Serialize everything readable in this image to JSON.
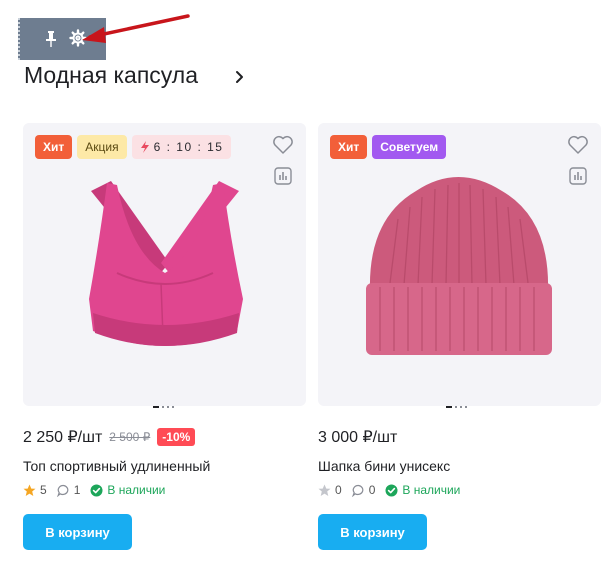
{
  "section": {
    "title": "Модная капсула"
  },
  "products": [
    {
      "badges": {
        "hit": "Хит",
        "sale": "Акция",
        "timer": "6 : 10 : 15"
      },
      "price": "2 250 ₽/шт",
      "old_price": "2 500 ₽",
      "discount": "-10%",
      "name": "Топ спортивный удлиненный",
      "rating": "5",
      "reviews": "1",
      "stock": "В наличии",
      "button": "В корзину",
      "image": "pink-sports-bra",
      "color": "#e0468f"
    },
    {
      "badges": {
        "hit": "Хит",
        "recommend": "Советуем"
      },
      "price": "3 000 ₽/шт",
      "name": "Шапка бини унисекс",
      "rating": "0",
      "reviews": "0",
      "stock": "В наличии",
      "button": "В корзину",
      "image": "pink-beanie",
      "color": "#cc5a7c"
    }
  ],
  "icons": {
    "toolbar": [
      "pin-icon",
      "gear-icon"
    ],
    "annotation": "red-arrow-icon",
    "card": [
      "heart-icon",
      "compare-icon",
      "star-icon",
      "comment-icon",
      "check-circle-icon",
      "bolt-icon"
    ]
  },
  "colors": {
    "accent_button": "#18adf1",
    "badge_hit": "#f25f39",
    "badge_sale": "#fde9a7",
    "badge_recommend": "#a259f0",
    "discount": "#ff4b55",
    "stock": "#1da65a",
    "star": "#f5a623"
  }
}
